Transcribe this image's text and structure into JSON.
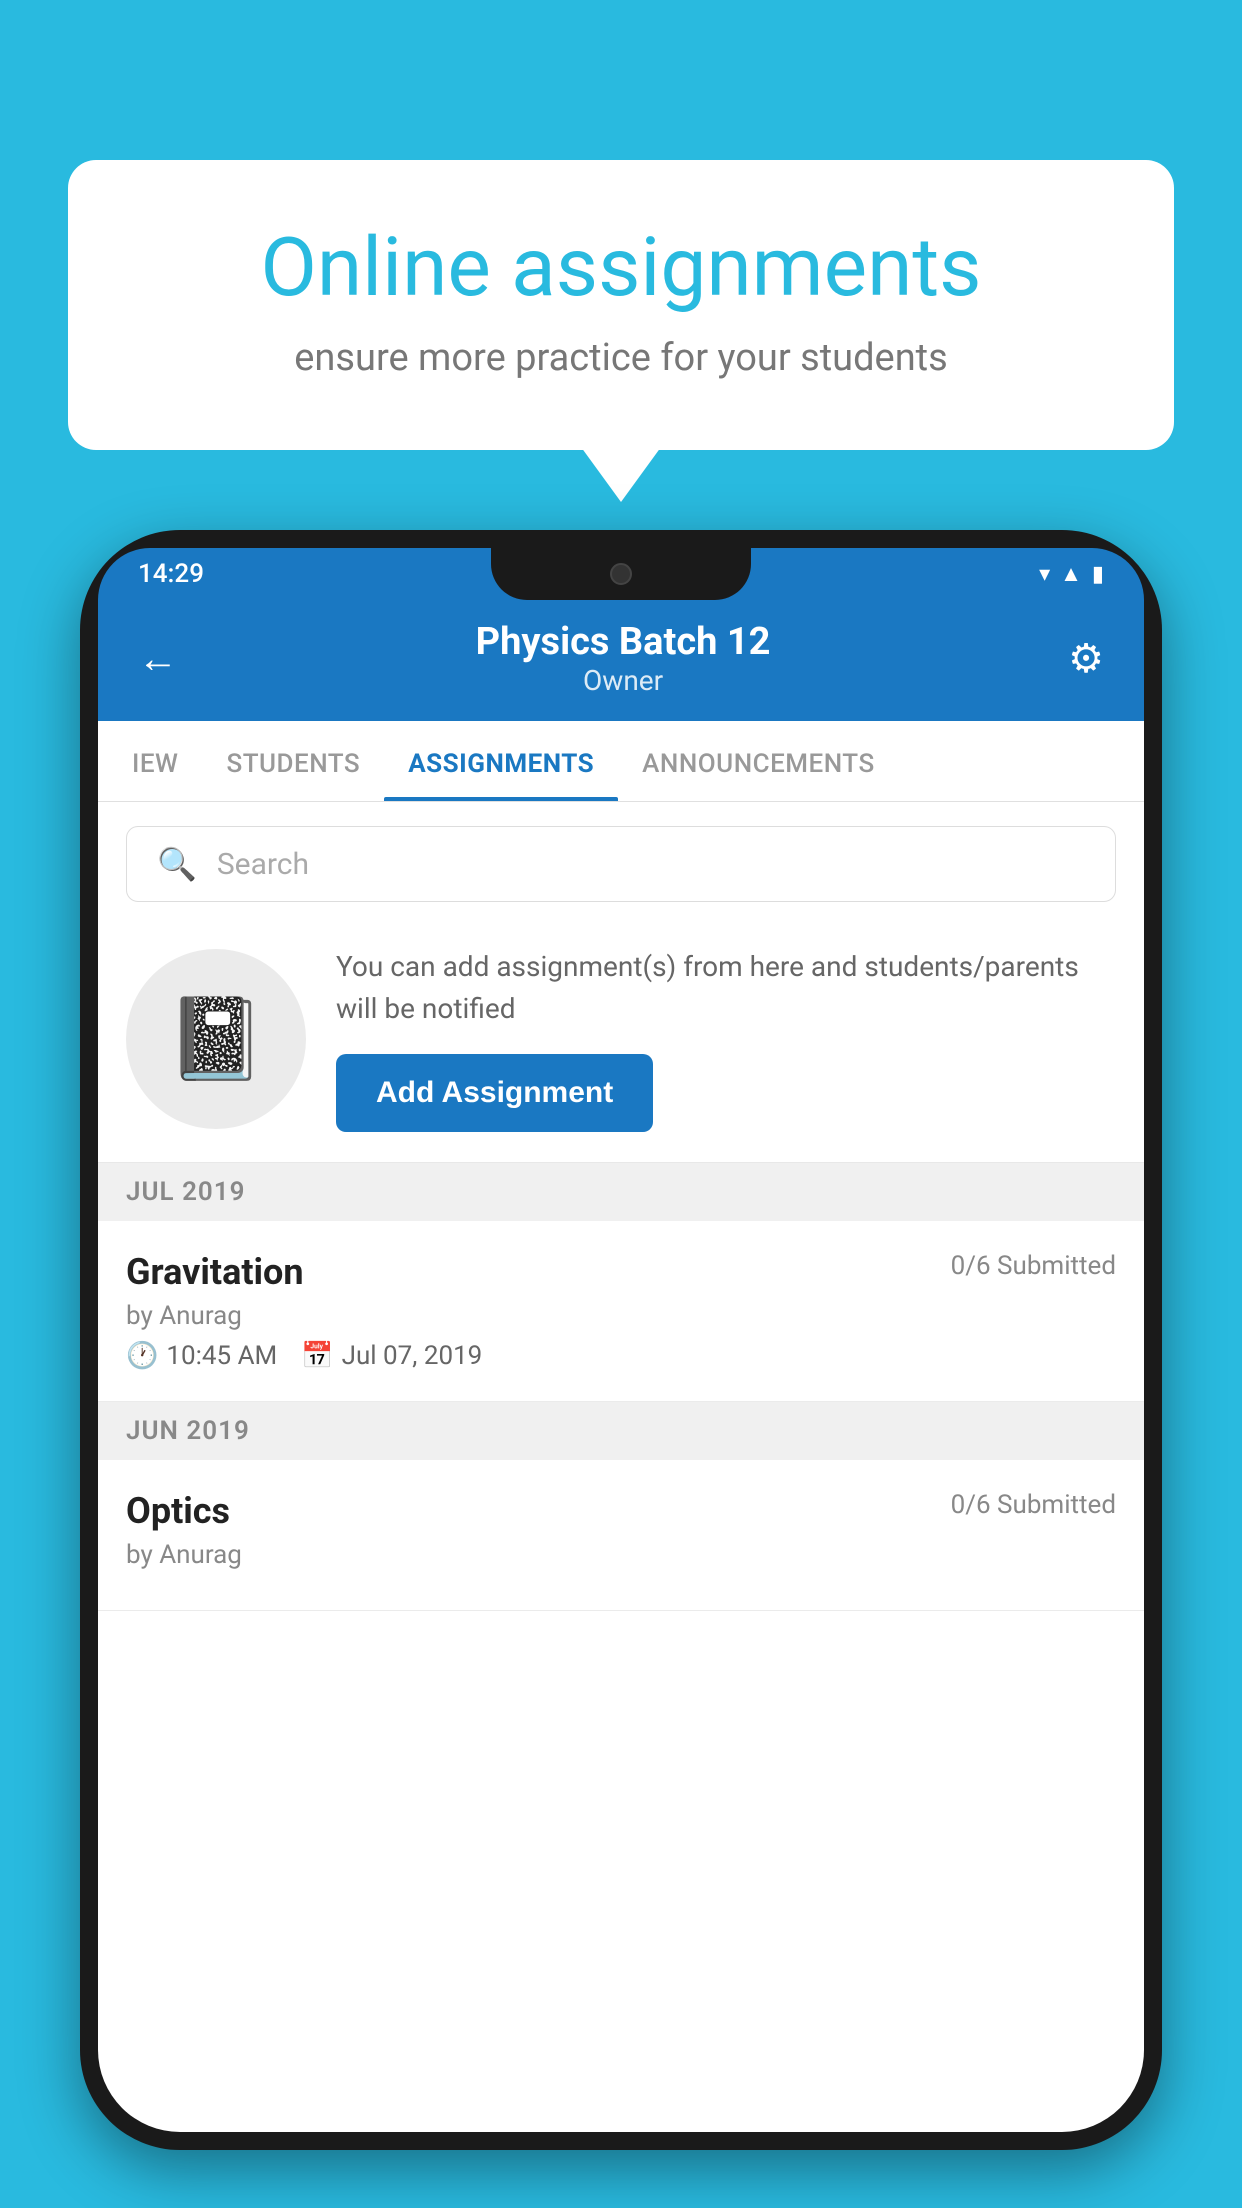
{
  "background_color": "#29BADF",
  "speech_bubble": {
    "title": "Online assignments",
    "subtitle": "ensure more practice for your students"
  },
  "phone": {
    "status_bar": {
      "time": "14:29",
      "icons": [
        "wifi",
        "signal",
        "battery"
      ]
    },
    "header": {
      "title": "Physics Batch 12",
      "subtitle": "Owner",
      "back_label": "←",
      "gear_label": "⚙"
    },
    "tabs": [
      {
        "label": "IEW",
        "active": false
      },
      {
        "label": "STUDENTS",
        "active": false
      },
      {
        "label": "ASSIGNMENTS",
        "active": true
      },
      {
        "label": "ANNOUNCEMENTS",
        "active": false
      }
    ],
    "search": {
      "placeholder": "Search"
    },
    "add_assignment_section": {
      "description": "You can add assignment(s) from here and students/parents will be notified",
      "button_label": "Add Assignment"
    },
    "assignment_sections": [
      {
        "month_label": "JUL 2019",
        "assignments": [
          {
            "name": "Gravitation",
            "submitted": "0/6 Submitted",
            "by": "by Anurag",
            "time": "10:45 AM",
            "date": "Jul 07, 2019"
          }
        ]
      },
      {
        "month_label": "JUN 2019",
        "assignments": [
          {
            "name": "Optics",
            "submitted": "0/6 Submitted",
            "by": "by Anurag",
            "time": "",
            "date": ""
          }
        ]
      }
    ]
  }
}
